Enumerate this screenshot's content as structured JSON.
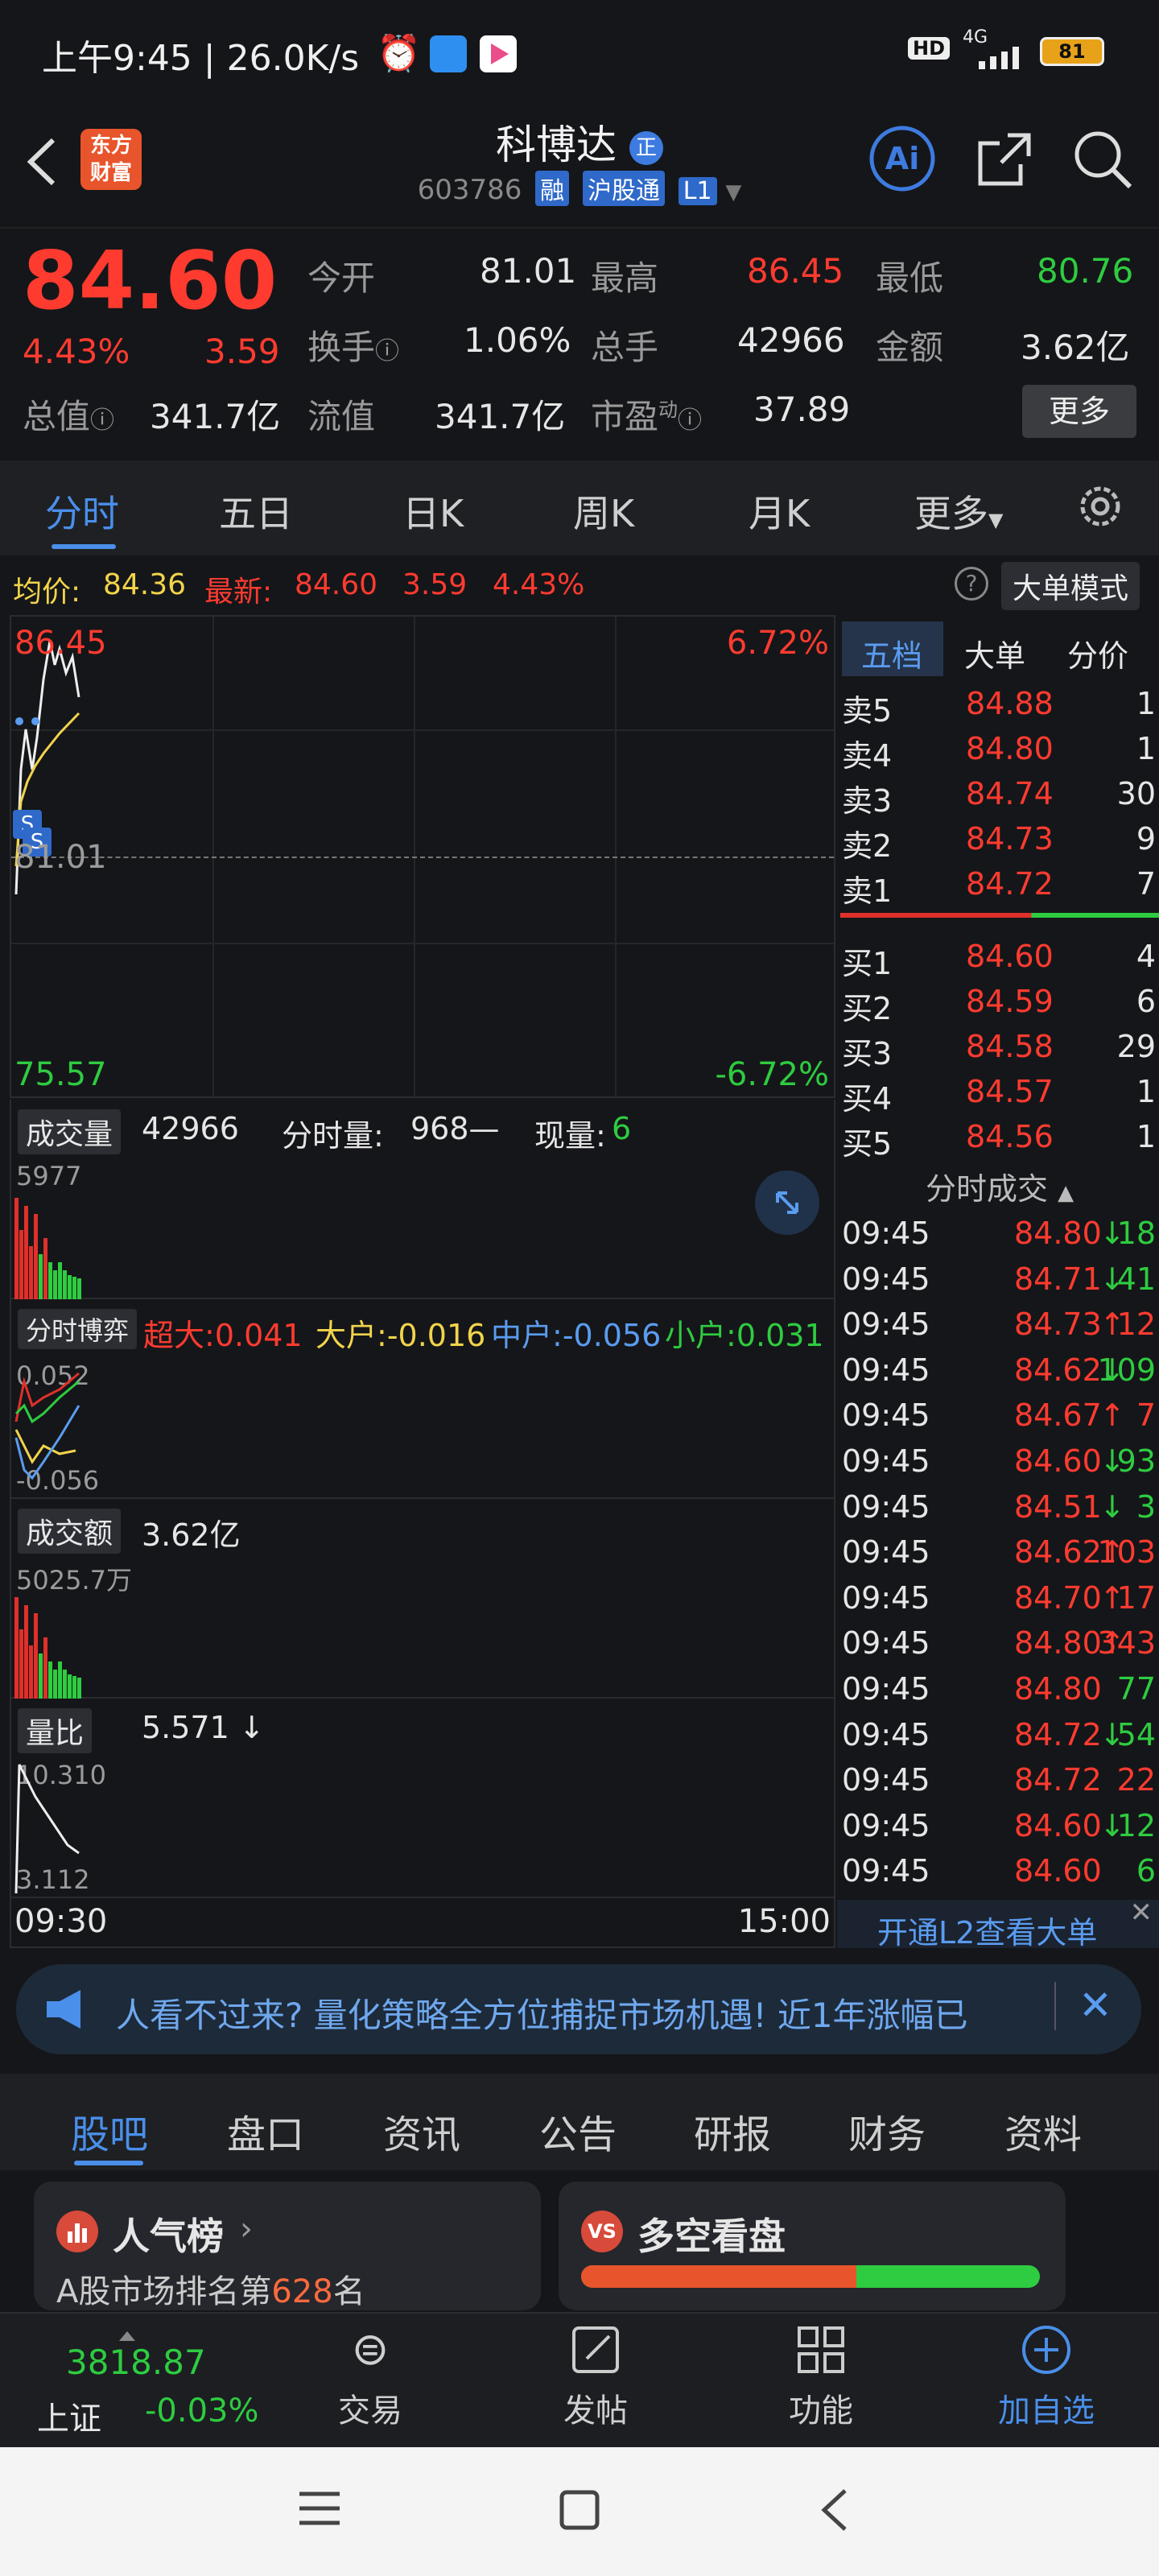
{
  "status_bar": {
    "time_speed": "上午9:45 | 26.0K/s",
    "network": "HD",
    "signal": "4G",
    "battery": "81"
  },
  "header": {
    "logo_text_1": "东方",
    "logo_text_2": "财富",
    "stock_name": "科博达",
    "stock_tag": "正",
    "stock_code": "603786",
    "tag_rong": "融",
    "tag_hgt": "沪股通",
    "tag_l1": "L1"
  },
  "quote": {
    "price": "84.60",
    "change_pct": "4.43%",
    "change_amt": "3.59",
    "open_label": "今开",
    "open_val": "81.01",
    "high_label": "最高",
    "high_val": "86.45",
    "low_label": "最低",
    "low_val": "80.76",
    "turnover_label": "换手",
    "turnover_val": "1.06%",
    "volume_label": "总手",
    "volume_val": "42966",
    "amount_label": "金额",
    "amount_val": "3.62亿",
    "mktcap_label": "总值",
    "mktcap_val": "341.7亿",
    "float_label": "流值",
    "float_val": "341.7亿",
    "pe_label": "市盈",
    "pe_sup": "动",
    "pe_val": "37.89",
    "more_label": "更多"
  },
  "tabs": [
    "分时",
    "五日",
    "日K",
    "周K",
    "月K",
    "更多"
  ],
  "infoline": {
    "avg_label": "均价:",
    "avg_val": "84.36",
    "latest_label": "最新:",
    "latest_val": "84.60",
    "latest_chg": "3.59",
    "latest_pct": "4.43%",
    "mode_btn": "大单模式"
  },
  "chart": {
    "top_price": "86.45",
    "top_pct": "6.72%",
    "mid_price": "81.01",
    "bottom_price": "75.57",
    "bottom_pct": "-6.72%"
  },
  "book": {
    "tabs": [
      "五档",
      "大单",
      "分价"
    ],
    "asks": [
      {
        "label": "卖5",
        "price": "84.88",
        "vol": "1"
      },
      {
        "label": "卖4",
        "price": "84.80",
        "vol": "1"
      },
      {
        "label": "卖3",
        "price": "84.74",
        "vol": "30"
      },
      {
        "label": "卖2",
        "price": "84.73",
        "vol": "9"
      },
      {
        "label": "卖1",
        "price": "84.72",
        "vol": "7"
      }
    ],
    "bids": [
      {
        "label": "买1",
        "price": "84.60",
        "vol": "4"
      },
      {
        "label": "买2",
        "price": "84.59",
        "vol": "6"
      },
      {
        "label": "买3",
        "price": "84.58",
        "vol": "29"
      },
      {
        "label": "买4",
        "price": "84.57",
        "vol": "1"
      },
      {
        "label": "买5",
        "price": "84.56",
        "vol": "1"
      }
    ],
    "trades_title": "分时成交",
    "trades": [
      {
        "t": "09:45",
        "p": "84.80",
        "d": "↓",
        "v": "18",
        "c": "red",
        "vc": "green"
      },
      {
        "t": "09:45",
        "p": "84.71",
        "d": "↓",
        "v": "41",
        "c": "red",
        "vc": "green"
      },
      {
        "t": "09:45",
        "p": "84.73",
        "d": "↑",
        "v": "12",
        "c": "red",
        "vc": "red"
      },
      {
        "t": "09:45",
        "p": "84.62",
        "d": "↓",
        "v": "109",
        "c": "red",
        "vc": "green"
      },
      {
        "t": "09:45",
        "p": "84.67",
        "d": "↑",
        "v": "7",
        "c": "red",
        "vc": "red"
      },
      {
        "t": "09:45",
        "p": "84.60",
        "d": "↓",
        "v": "93",
        "c": "red",
        "vc": "green"
      },
      {
        "t": "09:45",
        "p": "84.51",
        "d": "↓",
        "v": "3",
        "c": "red",
        "vc": "green"
      },
      {
        "t": "09:45",
        "p": "84.62",
        "d": "↑",
        "v": "103",
        "c": "red",
        "vc": "red"
      },
      {
        "t": "09:45",
        "p": "84.70",
        "d": "↑",
        "v": "17",
        "c": "red",
        "vc": "red"
      },
      {
        "t": "09:45",
        "p": "84.80",
        "d": "↑",
        "v": "343",
        "c": "red",
        "vc": "red"
      },
      {
        "t": "09:45",
        "p": "84.80",
        "d": "",
        "v": "77",
        "c": "red",
        "vc": "green"
      },
      {
        "t": "09:45",
        "p": "84.72",
        "d": "↓",
        "v": "54",
        "c": "red",
        "vc": "green"
      },
      {
        "t": "09:45",
        "p": "84.72",
        "d": "",
        "v": "22",
        "c": "red",
        "vc": "red"
      },
      {
        "t": "09:45",
        "p": "84.60",
        "d": "↓",
        "v": "12",
        "c": "red",
        "vc": "green"
      },
      {
        "t": "09:45",
        "p": "84.60",
        "d": "",
        "v": "6",
        "c": "red",
        "vc": "green"
      }
    ],
    "l2_link": "开通L2查看大单"
  },
  "vol_panel": {
    "dd": "成交量",
    "total": "42966",
    "min_label": "分时量:",
    "min_val": "968—",
    "cur_label": "现量:",
    "cur_val": "6",
    "max": "5977"
  },
  "flow_panel": {
    "dd": "分时博弈",
    "super_label": "超大:",
    "super_val": "0.041",
    "big_label": "大户:",
    "big_val": "-0.016",
    "mid_label": "中户:",
    "mid_val": "-0.056",
    "small_label": "小户:",
    "small_val": "0.031",
    "top": "0.052",
    "bottom": "-0.056"
  },
  "amount_panel": {
    "dd": "成交额",
    "total": "3.62亿",
    "max": "5025.7万"
  },
  "ratio_panel": {
    "dd": "量比",
    "val": "5.571",
    "arrow": "↓",
    "top": "10.310",
    "bottom": "3.112"
  },
  "time_axis": {
    "start": "09:30",
    "end": "15:00"
  },
  "banner": {
    "text": "人看不过来? 量化策略全方位捕捉市场机遇! 近1年涨幅已"
  },
  "section_tabs": [
    "股吧",
    "盘口",
    "资讯",
    "公告",
    "研报",
    "财务",
    "资料"
  ],
  "cards": {
    "hot_title": "人气榜",
    "hot_sub_prefix": "A股市场排名第",
    "hot_rank": "628",
    "hot_sub_suffix": "名",
    "vs_title": "多空看盘",
    "vs_bull_ratio": 0.6
  },
  "bottom_nav": {
    "index_val": "3818.87",
    "index_name": "上证",
    "index_chg": "-0.03%",
    "items": [
      "交易",
      "发帖",
      "功能",
      "加自选"
    ]
  }
}
